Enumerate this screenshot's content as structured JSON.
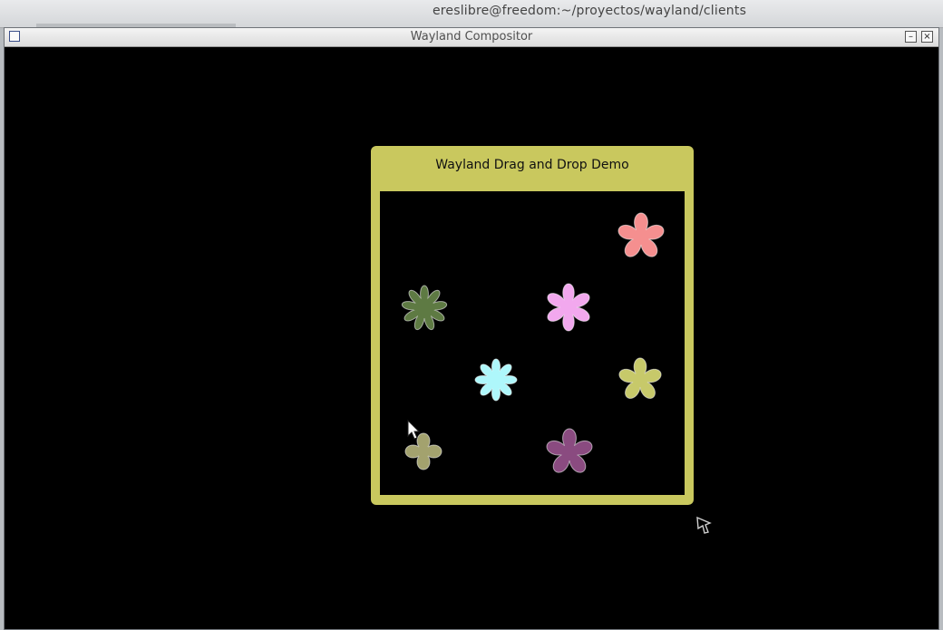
{
  "terminal": {
    "title": "ereslibre@freedom:~/proyectos/wayland/clients"
  },
  "compositor": {
    "title": "Wayland Compositor",
    "minimize_label": "–",
    "close_label": "×"
  },
  "demo": {
    "title": "Wayland Drag and Drop Demo",
    "accent": "#c9c85e",
    "flowers": [
      {
        "name": "flower-salmon",
        "petals": 5,
        "color": "#f58f8f"
      },
      {
        "name": "flower-darkgreen",
        "petals": 9,
        "color": "#5e7a43"
      },
      {
        "name": "flower-pink",
        "petals": 6,
        "color": "#f2a8ee"
      },
      {
        "name": "flower-cyan",
        "petals": 8,
        "color": "#aef7fb"
      },
      {
        "name": "flower-yellowgreen",
        "petals": 5,
        "color": "#c7c96a"
      },
      {
        "name": "flower-olive",
        "petals": 4,
        "color": "#a3a26e"
      },
      {
        "name": "flower-purple",
        "petals": 5,
        "color": "#8a4b80"
      }
    ]
  }
}
